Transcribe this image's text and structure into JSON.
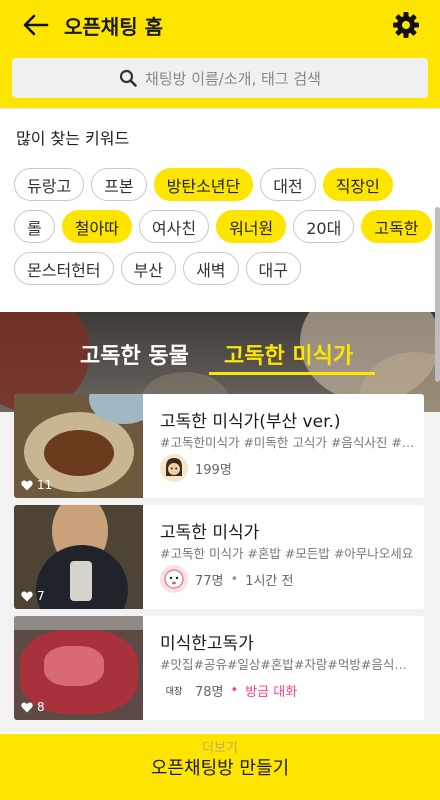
{
  "header": {
    "title": "오픈채팅 홈"
  },
  "search": {
    "placeholder": "채팅방 이름/소개, 태그 검색"
  },
  "keywords": {
    "title": "많이 찾는 키워드",
    "rows": [
      [
        {
          "label": "듀랑고",
          "highlighted": false
        },
        {
          "label": "프본",
          "highlighted": false
        },
        {
          "label": "방탄소년단",
          "highlighted": true
        },
        {
          "label": "대전",
          "highlighted": false
        },
        {
          "label": "직장인",
          "highlighted": true
        }
      ],
      [
        {
          "label": "롤",
          "highlighted": false
        },
        {
          "label": "철아따",
          "highlighted": true
        },
        {
          "label": "여사친",
          "highlighted": false
        },
        {
          "label": "워너원",
          "highlighted": true
        },
        {
          "label": "20대",
          "highlighted": false
        },
        {
          "label": "고독한",
          "highlighted": true
        }
      ],
      [
        {
          "label": "몬스터헌터",
          "highlighted": false
        },
        {
          "label": "부산",
          "highlighted": false
        },
        {
          "label": "새벽",
          "highlighted": false
        },
        {
          "label": "대구",
          "highlighted": false
        }
      ]
    ]
  },
  "tabs": [
    {
      "label": "고독한 동물",
      "active": false
    },
    {
      "label": "고독한 미식가",
      "active": true
    }
  ],
  "rooms": [
    {
      "title": "고독한 미식가(부산 ver.)",
      "tags": "#고독한미식가 #미독한 고식가 #음식사진 #…",
      "members": "199명",
      "time": "",
      "recent": "",
      "likes": "11"
    },
    {
      "title": "고독한 미식가",
      "tags": "#고독한 미식가 #혼밥 #모든밥 #아무나오세요",
      "members": "77명",
      "time": "1시간 전",
      "recent": "",
      "likes": "7"
    },
    {
      "title": "미식한고독가",
      "tags": "#맛집#공유#일상#혼밥#자랑#먹방#음식짤#…",
      "members": "78명",
      "time": "",
      "recent": "방금 대화",
      "likes": "8",
      "avatar_text": "대장"
    }
  ],
  "footer": {
    "more_label": "더보기",
    "create_label": "오픈채팅방 만들기"
  },
  "colors": {
    "accent": "#fee500",
    "recent": "#ff3f8a"
  }
}
